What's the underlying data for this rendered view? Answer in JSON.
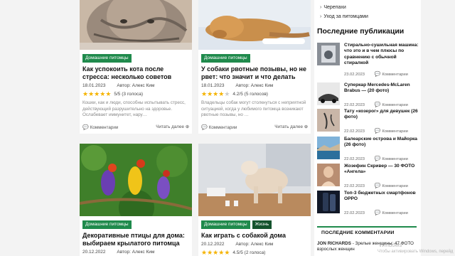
{
  "cards": [
    {
      "tags": [
        "Домашние питомцы"
      ],
      "title": "Как успокоить кота после стресса: несколько советов",
      "date": "18.01.2023",
      "author": "Автор: Алекс Ким",
      "stars": 5,
      "score": "5/5 (3 голоса)",
      "excerpt": "Кошки, как и люди, способны испытывать стресс, действующий разрушительно на здоровье. Ослабевает иммунитет, нару…",
      "comments": "Комментарии",
      "read_more": "Читать далее"
    },
    {
      "tags": [
        "Домашние питомцы"
      ],
      "title": "У собаки рвотные позывы, но не рвет: что значит и что делать",
      "date": "18.01.2023",
      "author": "Автор: Алекс Ким",
      "stars": 4,
      "score": "4.2/5 (5 голосов)",
      "excerpt": "Владельцы собак могут столкнуться с неприятной ситуацией, когда у любимого питомца возникают рвотные позывы, но …",
      "comments": "Комментарии",
      "read_more": "Читать далее"
    },
    {
      "tags": [
        "Домашние питомцы"
      ],
      "title": "Декоративные птицы для дома: выбираем крылатого питомца",
      "date": "20.12.2022",
      "author": "Автор: Алекс Ким"
    },
    {
      "tags": [
        "Домашние питомцы",
        "Жизнь"
      ],
      "title": "Как играть с собакой дома",
      "date": "20.12.2022",
      "author": "Автор: Алекс Ким",
      "stars": 5,
      "score": "4.5/5 (2 голоса)"
    }
  ],
  "sidebar": {
    "links": [
      "Черепахи",
      "Уход за питомцами"
    ],
    "heading": "Последние публикации",
    "pubs": [
      {
        "title": "Стирально-сушильная машина: что это и в чем плюсы по сравнению с обычной стиралкой",
        "date": "23.02.2023",
        "comments": "Комментарии"
      },
      {
        "title": "Суперкар Mercedes-McLaren Brabus — (20 фото)",
        "date": "22.02.2023",
        "comments": "Комментарии"
      },
      {
        "title": "Тату «козерог» для девушек (26 фото)",
        "date": "22.02.2023",
        "comments": "Комментарии"
      },
      {
        "title": "Балеарские острова и Майорка (26 фото)",
        "date": "22.02.2023",
        "comments": "Комментарии"
      },
      {
        "title": "Жозефин Скривер — 30 ФОТО «Ангела»",
        "date": "22.02.2023",
        "comments": "Комментарии"
      },
      {
        "title": "Топ-3 бюджетных смартфонов OPPO",
        "date": "22.02.2023",
        "comments": "Комментарии"
      }
    ],
    "comments_heading": "ПОСЛЕДНИЕ КОММЕНТАРИИ",
    "last_comment_author": "JON RICHARDS",
    "last_comment_text": "- Зрелые женщины: 47 ФОТО взрослых женщин"
  },
  "watermark": {
    "line1": "Windows",
    "line2": "Чтобы активировать Windows, перейд"
  },
  "colors": {
    "accent": "#1f8a4c",
    "star": "#f5b301"
  }
}
